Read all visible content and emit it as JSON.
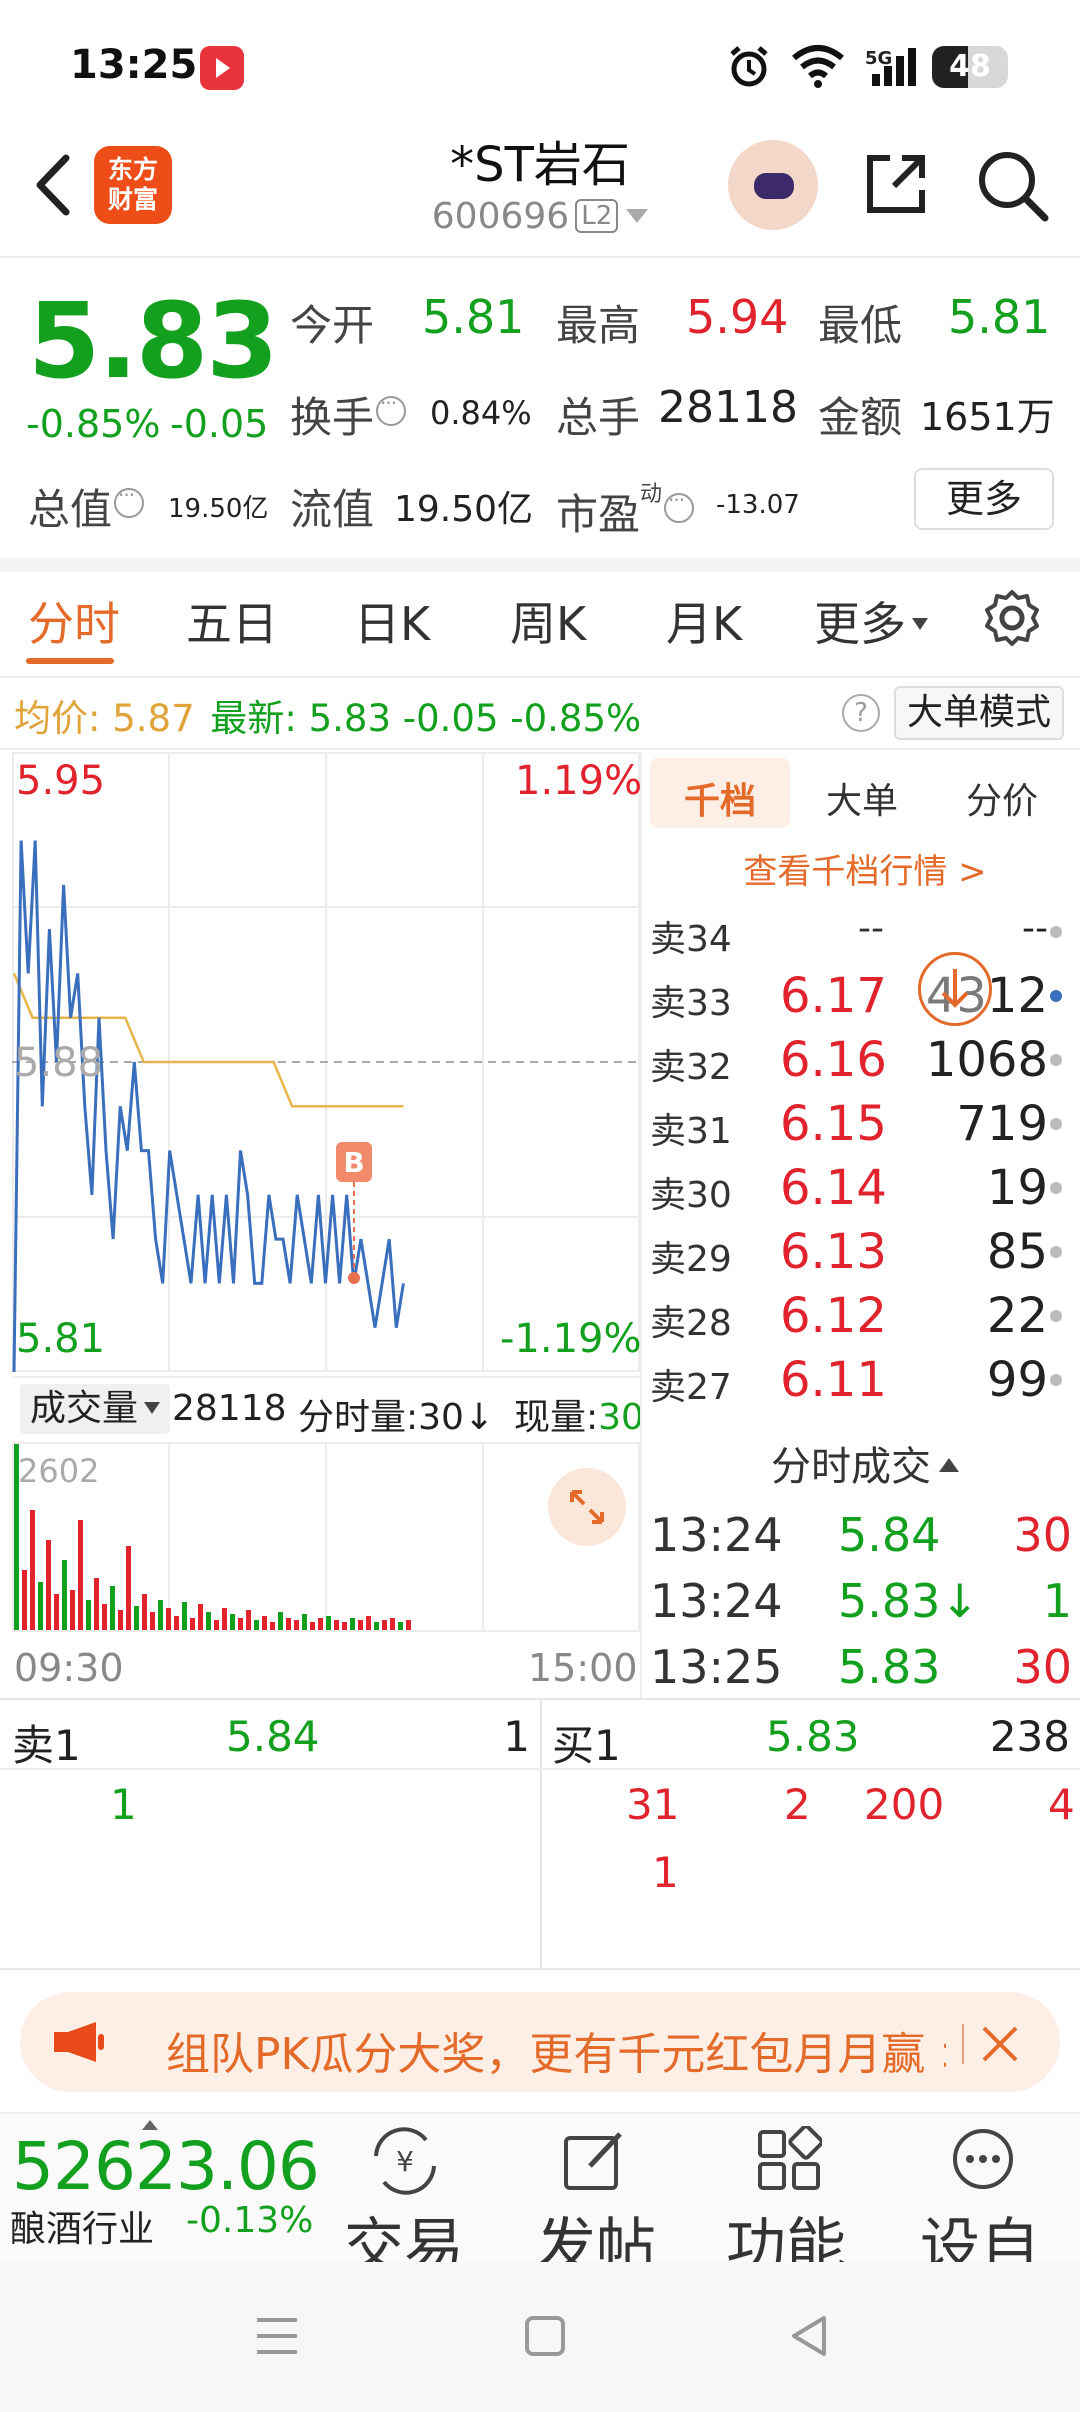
{
  "status_bar": {
    "time": "13:25",
    "network": "5G",
    "battery": "48",
    "battery_level_pct": 48
  },
  "header": {
    "stock_name": "*ST岩石",
    "stock_code": "600696",
    "level_badge": "L2"
  },
  "quote": {
    "last_price": "5.83",
    "change_pct": "-0.85%",
    "change_abs": "-0.05",
    "open_label": "今开",
    "open": "5.81",
    "high_label": "最高",
    "high": "5.94",
    "low_label": "最低",
    "low": "5.81",
    "turnover_label": "换手",
    "turnover": "0.84%",
    "volume_label": "总手",
    "volume": "28118",
    "amount_label": "金额",
    "amount": "1651万",
    "mktcap_label": "总值",
    "mktcap": "19.50亿",
    "float_label": "流值",
    "float_cap": "19.50亿",
    "pe_label": "市盈",
    "pe_sup": "动",
    "pe": "-13.07",
    "more_button": "更多"
  },
  "tabs": [
    {
      "label": "分时",
      "active": true
    },
    {
      "label": "五日"
    },
    {
      "label": "日K"
    },
    {
      "label": "周K"
    },
    {
      "label": "月K"
    },
    {
      "label": "更多"
    }
  ],
  "avg_bar": {
    "avg_label": "均价:",
    "avg_value": "5.87",
    "latest_label": "最新:",
    "latest_price": "5.83",
    "latest_change": "-0.05",
    "latest_pct": "-0.85%",
    "help": "?",
    "big_order_button": "大单模式"
  },
  "chart": {
    "price_high": "5.95",
    "price_low": "5.81",
    "price_mid": "5.88",
    "pct_high": "1.19%",
    "pct_low": "-1.19%",
    "marker_label": "B",
    "volume_mode": "成交量",
    "volume_total": "28118",
    "volume_minute_label": "分时量:30↓",
    "volume_now_label": "现量:",
    "volume_now": "30",
    "volume_max": "2602",
    "time_start": "09:30",
    "time_end": "15:00",
    "colors": {
      "price_line": "#3a6fbd",
      "avg_line": "#e8b54a",
      "up": "#e0232c",
      "down": "#12a01e"
    }
  },
  "chart_data": {
    "type": "line",
    "title": "",
    "xlabel": "",
    "ylabel": "",
    "ylim": [
      5.81,
      5.95
    ],
    "x_range": [
      "09:30",
      "15:00"
    ],
    "series": [
      {
        "values": [
          5.81,
          5.93,
          5.9,
          5.93,
          5.87,
          5.91,
          5.88,
          5.92,
          5.89,
          5.9,
          5.87,
          5.85,
          5.89,
          5.86,
          5.84,
          5.87,
          5.86,
          5.88,
          5.86,
          5.86,
          5.84,
          5.83,
          5.86,
          5.85,
          5.84,
          5.83,
          5.85,
          5.83,
          5.85,
          5.83,
          5.85,
          5.83,
          5.86,
          5.85,
          5.83,
          5.83,
          5.85,
          5.84,
          5.84,
          5.83,
          5.85,
          5.84,
          5.83,
          5.85,
          5.83,
          5.85,
          5.83,
          5.85,
          5.83,
          5.84,
          5.83,
          5.82,
          5.83,
          5.84,
          5.82,
          5.83
        ]
      },
      {
        "values": [
          5.9,
          5.89,
          5.89,
          5.89,
          5.89,
          5.89,
          5.89,
          5.88,
          5.88,
          5.88,
          5.88,
          5.88,
          5.88,
          5.88,
          5.88,
          5.87,
          5.87,
          5.87,
          5.87,
          5.87,
          5.87,
          5.87
        ]
      }
    ]
  },
  "order_book": {
    "tabs": [
      "千档",
      "大单",
      "分价"
    ],
    "view_link": "查看千档行情 >",
    "asks": [
      {
        "label": "卖34",
        "price": "--",
        "qty": "--"
      },
      {
        "label": "卖33",
        "price": "6.17",
        "qty": "4312"
      },
      {
        "label": "卖32",
        "price": "6.16",
        "qty": "1068"
      },
      {
        "label": "卖31",
        "price": "6.15",
        "qty": "719"
      },
      {
        "label": "卖30",
        "price": "6.14",
        "qty": "19"
      },
      {
        "label": "卖29",
        "price": "6.13",
        "qty": "85"
      },
      {
        "label": "卖28",
        "price": "6.12",
        "qty": "22"
      },
      {
        "label": "卖27",
        "price": "6.11",
        "qty": "99"
      }
    ],
    "ticks_header": "分时成交",
    "ticks": [
      {
        "time": "13:24",
        "price": "5.84",
        "qty": "30"
      },
      {
        "time": "13:24",
        "price": "5.83↓",
        "qty": "1"
      },
      {
        "time": "13:25",
        "price": "5.83",
        "qty": "30"
      }
    ]
  },
  "level1": {
    "sell_label": "卖1",
    "sell_price": "5.84",
    "sell_qty": "1",
    "buy_label": "买1",
    "buy_price": "5.83",
    "buy_qty": "238",
    "sell_orders": [
      "1"
    ],
    "buy_orders_row1": [
      "31",
      "2",
      "200",
      "4"
    ],
    "buy_orders_row2": [
      "1"
    ]
  },
  "banner": {
    "text": "组队PK瓜分大奖，更有千元红包月月赢 >"
  },
  "bottom_bar": {
    "index_value": "52623.06",
    "index_name": "酿酒行业",
    "index_pct": "-0.13%",
    "actions": [
      "交易",
      "发帖",
      "功能",
      "设自"
    ]
  }
}
